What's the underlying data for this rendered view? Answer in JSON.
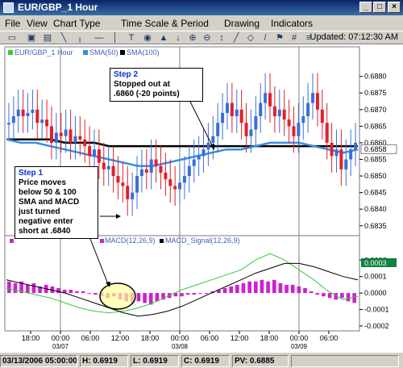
{
  "window": {
    "title": "EUR/GBP_1 Hour"
  },
  "menu": [
    "File",
    "View",
    "Chart Type",
    "Time Scale & Period",
    "Drawing",
    "Indicators"
  ],
  "toolbar": {
    "icons": [
      "print-icon",
      "save-icon",
      "chart-icon",
      "line-tool-icon",
      "pointer-icon",
      "horizontal-line-icon",
      "vertical-line-icon",
      "text-icon",
      "circle-icon",
      "arrow-down-icon",
      "arrow-up-icon",
      "zoom-in-icon",
      "zoom-out-icon",
      "scroll-icon",
      "trend-icon",
      "ruler-icon",
      "fib-icon",
      "signal-icon",
      "properties-icon",
      "settings-icon",
      "flag-icon",
      "grid-icon"
    ],
    "updated": "Updated: 07:12:30 AM"
  },
  "legend": {
    "series1": "EUR/GBP_1 Hour",
    "series2": "SMA(50)",
    "series3": "SMA(100)",
    "macd1": "MACD(12,26,9)",
    "macd2": "MACD_Signal(12,26,9)"
  },
  "colors": {
    "bull": "#3a6fd8",
    "bear": "#e0202a",
    "sma50": "#3a8ee0",
    "sma100": "#000000",
    "macd": "#cc22cc",
    "signal": "#33cc33",
    "macd_line": "#000000",
    "axis_label_bg": "#108040",
    "highlight": "#ffff99"
  },
  "price_axis": {
    "ticks": [
      "0.6880",
      "0.6875",
      "0.6870",
      "0.6865",
      "0.6860",
      "0.6855",
      "0.6850",
      "0.6845",
      "0.6840",
      "0.6835"
    ],
    "current": "0.6858"
  },
  "macd_axis": {
    "ticks": [
      "0.0002",
      "0.0001",
      "0.0000",
      "-0.0001",
      "-0.0002"
    ],
    "current": "0.0003"
  },
  "time_axis": [
    {
      "label": "18:00",
      "sub": ""
    },
    {
      "label": "00:00",
      "sub": "03/07"
    },
    {
      "label": "06:00",
      "sub": ""
    },
    {
      "label": "12:00",
      "sub": ""
    },
    {
      "label": "18:00",
      "sub": ""
    },
    {
      "label": "00:00",
      "sub": "03/08"
    },
    {
      "label": "06:00",
      "sub": ""
    },
    {
      "label": "12:00",
      "sub": ""
    },
    {
      "label": "18:00",
      "sub": ""
    },
    {
      "label": "00:00",
      "sub": "03/09"
    },
    {
      "label": "06:00",
      "sub": ""
    }
  ],
  "callouts": {
    "step1_title": "Step 1",
    "step1_lines": [
      "Price moves",
      "below 50 & 100",
      "SMA and MACD",
      "just turned",
      "negative enter",
      "short at .6840"
    ],
    "step2_title": "Step 2",
    "step2_lines": [
      "Stopped out at",
      ".6860 (-20 points)"
    ]
  },
  "status": {
    "date": "03/13/2006 05:00:00",
    "high": "H: 0.6919",
    "low": "L: 0.6919",
    "close": "C: 0.6919",
    "pv": "PV: 0.6885"
  },
  "chart_data": {
    "type": "candlestick",
    "title": "EUR/GBP_1 Hour",
    "price_range": [
      0.6833,
      0.6886
    ],
    "macd_range": [
      -0.00022,
      0.00028
    ],
    "candles_close_approx": [
      0.6866,
      0.6868,
      0.687,
      0.6868,
      0.6869,
      0.687,
      0.6866,
      0.6867,
      0.6865,
      0.686,
      0.6863,
      0.6862,
      0.6864,
      0.686,
      0.6862,
      0.6861,
      0.6859,
      0.6856,
      0.6858,
      0.6854,
      0.6852,
      0.6853,
      0.685,
      0.6848,
      0.6847,
      0.6843,
      0.6845,
      0.685,
      0.6852,
      0.6851,
      0.6855,
      0.6853,
      0.6851,
      0.6849,
      0.6847,
      0.6846,
      0.6848,
      0.685,
      0.6853,
      0.6855,
      0.6856,
      0.6858,
      0.686,
      0.6862,
      0.6866,
      0.6869,
      0.6872,
      0.6868,
      0.687,
      0.6866,
      0.6862,
      0.6864,
      0.6868,
      0.6872,
      0.6875,
      0.6871,
      0.6868,
      0.687,
      0.6867,
      0.6865,
      0.6862,
      0.6866,
      0.6868,
      0.6872,
      0.6875,
      0.687,
      0.6866,
      0.686,
      0.6856,
      0.6858,
      0.6852,
      0.6855,
      0.6858,
      0.686
    ],
    "sma50": [
      0.6861,
      0.686,
      0.686,
      0.6859,
      0.6858,
      0.6857,
      0.6856,
      0.6855,
      0.6854,
      0.6853,
      0.6853,
      0.6854,
      0.6855,
      0.6856,
      0.6857,
      0.6858,
      0.6858,
      0.6859,
      0.686,
      0.686,
      0.686,
      0.6859,
      0.6858,
      0.6857,
      0.6858
    ],
    "sma100": [
      0.6861,
      0.6861,
      0.6861,
      0.6861,
      0.686,
      0.686,
      0.686,
      0.6859,
      0.6859,
      0.6859,
      0.6859,
      0.6859,
      0.6859,
      0.6859,
      0.6859,
      0.6859,
      0.6859,
      0.6859,
      0.6859,
      0.6859,
      0.6859,
      0.6859,
      0.6859,
      0.6859,
      0.6859
    ],
    "macd_hist": [
      7e-05,
      6e-05,
      7e-05,
      5e-05,
      6e-05,
      4e-05,
      5e-05,
      4e-05,
      3e-05,
      2e-05,
      2e-05,
      1e-05,
      1e-05,
      0.0,
      -1e-05,
      -2e-05,
      -3e-05,
      -2e-05,
      -4e-05,
      -5e-05,
      -6e-05,
      -5e-05,
      -6e-05,
      -7e-05,
      -5e-05,
      -4e-05,
      -3e-05,
      -2e-05,
      -2e-05,
      -1e-05,
      -1e-05,
      0.0,
      0.0,
      1e-05,
      2e-05,
      3e-05,
      4e-05,
      5e-05,
      6e-05,
      7e-05,
      7e-05,
      8e-05,
      7e-05,
      8e-05,
      6e-05,
      5e-05,
      5e-05,
      4e-05,
      3e-05,
      1e-05,
      -1e-05,
      -2e-05,
      -3e-05,
      -4e-05,
      -3e-05,
      -5e-05,
      -6e-05
    ],
    "macd_line": [
      8e-05,
      6e-05,
      4e-05,
      2e-05,
      0.0,
      -3e-05,
      -6e-05,
      -9e-05,
      -0.00012,
      -0.00014,
      -0.00013,
      -0.00011,
      -8e-05,
      -4e-05,
      0.0,
      4e-05,
      8e-05,
      0.00012,
      0.00015,
      0.00018,
      0.00018,
      0.00016,
      0.00013,
      0.0001,
      8e-05
    ],
    "signal_line": [
      3e-05,
      1e-05,
      -1e-05,
      -3e-05,
      -6e-05,
      -9e-05,
      -0.00011,
      -0.00012,
      -0.00011,
      -9e-05,
      -6e-05,
      -2e-05,
      2e-05,
      5e-05,
      8e-05,
      0.00011,
      0.00014,
      0.0002,
      0.00024,
      0.0002,
      0.00014,
      8e-05,
      1e-05,
      -4e-05,
      -2e-05
    ]
  }
}
